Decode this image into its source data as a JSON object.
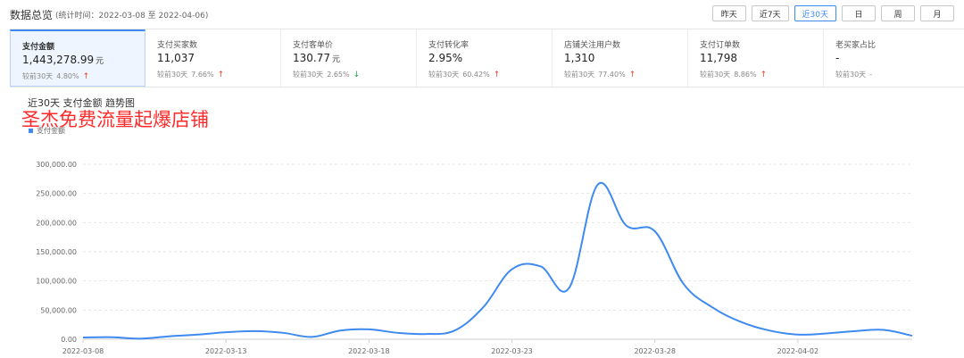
{
  "header": {
    "title": "数据总览",
    "period": "(统计时间：2022-03-08 至 2022-04-06)",
    "range_buttons": [
      {
        "label": "昨天",
        "active": false
      },
      {
        "label": "近7天",
        "active": false
      },
      {
        "label": "近30天",
        "active": true
      },
      {
        "label": "日",
        "active": false
      },
      {
        "label": "周",
        "active": false
      },
      {
        "label": "月",
        "active": false
      }
    ]
  },
  "metrics": [
    {
      "label": "支付金额",
      "value": "1,443,278.99",
      "unit": "元",
      "compare_label": "较前30天",
      "compare_value": "4.80%",
      "trend": "up",
      "active": true
    },
    {
      "label": "支付买家数",
      "value": "11,037",
      "unit": "",
      "compare_label": "较前30天",
      "compare_value": "7.66%",
      "trend": "up",
      "active": false
    },
    {
      "label": "支付客单价",
      "value": "130.77",
      "unit": "元",
      "compare_label": "较前30天",
      "compare_value": "2.65%",
      "trend": "down",
      "active": false
    },
    {
      "label": "支付转化率",
      "value": "2.95%",
      "unit": "",
      "compare_label": "较前30天",
      "compare_value": "60.42%",
      "trend": "up",
      "active": false
    },
    {
      "label": "店铺关注用户数",
      "value": "1,310",
      "unit": "",
      "compare_label": "较前30天",
      "compare_value": "77.40%",
      "trend": "up",
      "active": false
    },
    {
      "label": "支付订单数",
      "value": "11,798",
      "unit": "",
      "compare_label": "较前30天",
      "compare_value": "8.86%",
      "trend": "up",
      "active": false
    },
    {
      "label": "老买家占比",
      "value": "-",
      "unit": "",
      "compare_label": "较前30天",
      "compare_value": "-",
      "trend": "none",
      "active": false
    }
  ],
  "watermark": "圣杰免费流量起爆店铺",
  "colors": {
    "accent": "#3e8af0",
    "up": "#e8452f",
    "down": "#1ea84a",
    "watermark": "#ff2a2a"
  },
  "chart_data": {
    "type": "line",
    "title": "近30天 支付金额 趋势图",
    "legend": [
      "支付金额"
    ],
    "legend_position": "top-left",
    "grid": true,
    "ylim": [
      0,
      300000
    ],
    "yticks": [
      0,
      50000,
      100000,
      150000,
      200000,
      250000,
      300000
    ],
    "ytick_labels": [
      "0.00",
      "50,000.00",
      "100,000.00",
      "150,000.00",
      "200,000.00",
      "250,000.00",
      "300,000.00"
    ],
    "x": [
      "2022-03-08",
      "2022-03-09",
      "2022-03-10",
      "2022-03-11",
      "2022-03-12",
      "2022-03-13",
      "2022-03-14",
      "2022-03-15",
      "2022-03-16",
      "2022-03-17",
      "2022-03-18",
      "2022-03-19",
      "2022-03-20",
      "2022-03-21",
      "2022-03-22",
      "2022-03-23",
      "2022-03-24",
      "2022-03-25",
      "2022-03-26",
      "2022-03-27",
      "2022-03-28",
      "2022-03-29",
      "2022-03-30",
      "2022-03-31",
      "2022-04-01",
      "2022-04-02",
      "2022-04-03",
      "2022-04-04",
      "2022-04-05",
      "2022-04-06"
    ],
    "xtick_labels": [
      "2022-03-08",
      "2022-03-13",
      "2022-03-18",
      "2022-03-23",
      "2022-03-28",
      "2022-04-02"
    ],
    "series": [
      {
        "name": "支付金额",
        "color": "#3e8af0",
        "values": [
          3000,
          3500,
          1000,
          5000,
          8000,
          12000,
          14000,
          11000,
          4000,
          15000,
          17000,
          11000,
          9000,
          15000,
          55000,
          120000,
          125000,
          88000,
          265000,
          195000,
          185000,
          95000,
          55000,
          30000,
          15000,
          8000,
          10000,
          14000,
          16000,
          6000
        ]
      }
    ]
  }
}
